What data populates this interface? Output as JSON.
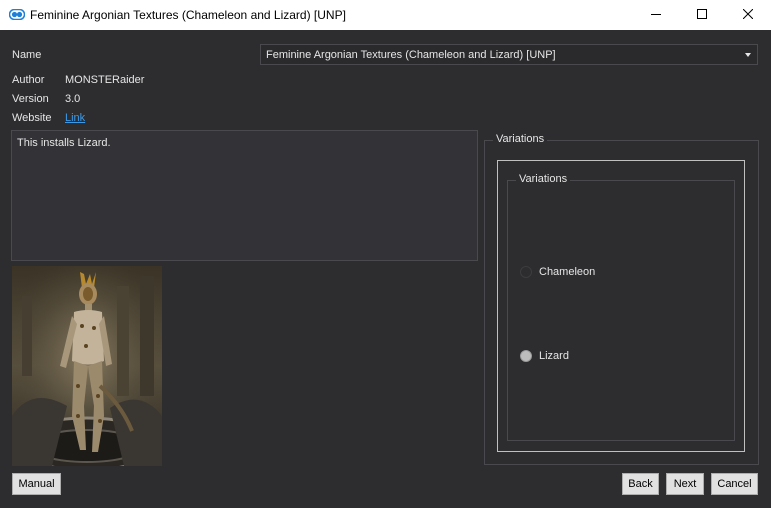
{
  "window": {
    "title": "Feminine Argonian Textures (Chameleon and Lizard) [UNP]",
    "icon": "app-cloud-icon"
  },
  "window_controls": [
    "minimize-icon",
    "maximize-icon",
    "close-icon"
  ],
  "fields": {
    "name_label": "Name",
    "name_value": "Feminine Argonian Textures (Chameleon and Lizard) [UNP]",
    "author_label": "Author",
    "author_value": "MONSTERaider",
    "version_label": "Version",
    "version_value": "3.0",
    "website_label": "Website",
    "website_link": "Link"
  },
  "description": "This installs Lizard.",
  "groups": {
    "outer_title": "Variations",
    "inner_title": "Variations",
    "options": [
      {
        "label": "Chameleon",
        "selected": false
      },
      {
        "label": "Lizard",
        "selected": true
      }
    ]
  },
  "buttons": {
    "manual": "Manual",
    "back": "Back",
    "next": "Next",
    "cancel": "Cancel"
  },
  "colors": {
    "background": "#2d2d30",
    "link": "#3b9ae8",
    "button_face": "#e1e1e1"
  }
}
